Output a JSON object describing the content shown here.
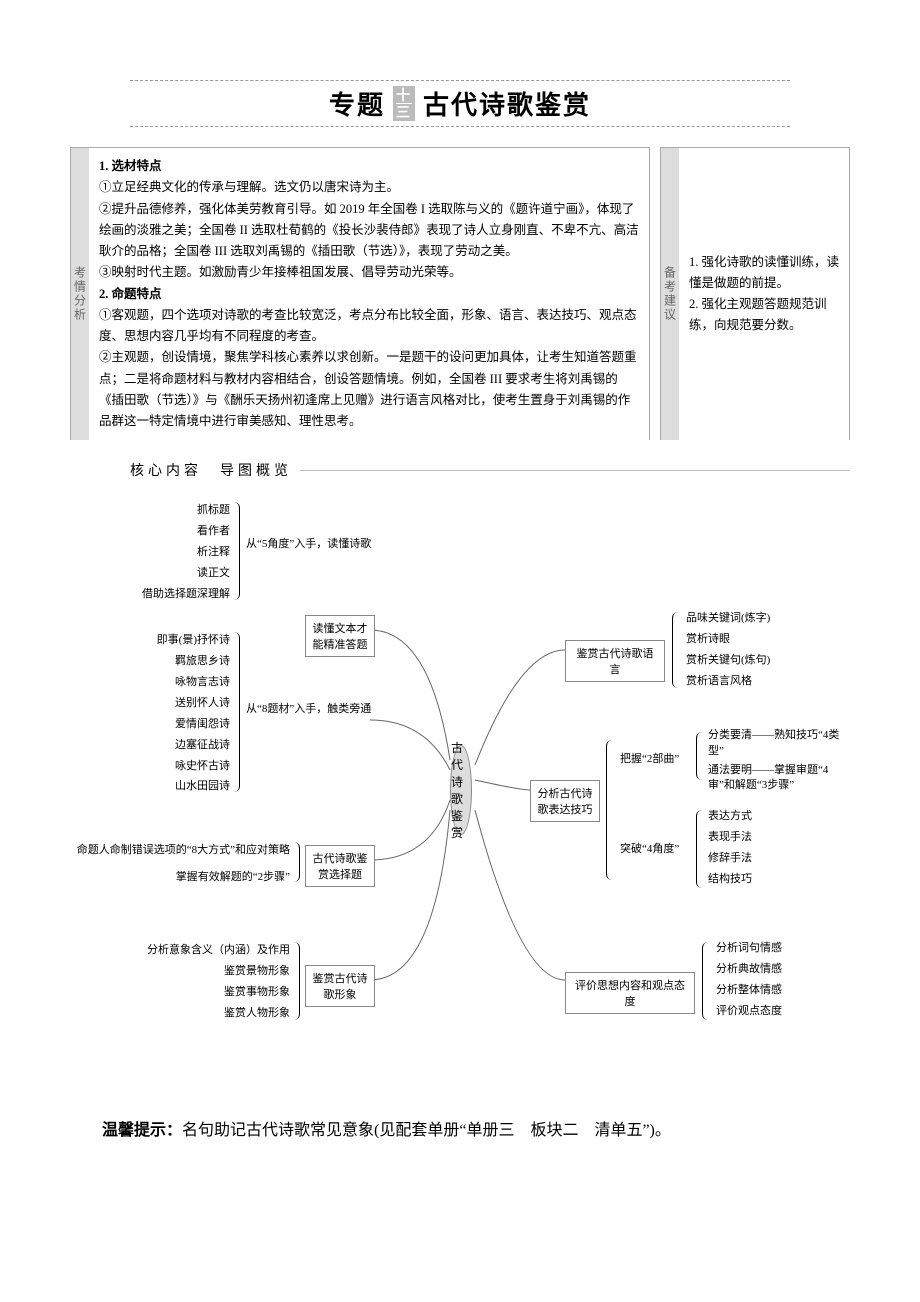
{
  "title": {
    "topic": "专题",
    "num_top": "十",
    "num_bottom": "三",
    "subject": "古代诗歌鉴赏"
  },
  "left": {
    "label": "考情分析",
    "h1": "1. 选材特点",
    "p1": "①立足经典文化的传承与理解。选文仍以唐宋诗为主。",
    "p2": "②提升品德修养，强化体美劳教育引导。如 2019 年全国卷 I 选取陈与义的《题许道宁画》，体现了绘画的淡雅之美；全国卷 II 选取杜荀鹤的《投长沙裴侍郎》表现了诗人立身刚直、不卑不亢、高洁耿介的品格；全国卷 III 选取刘禹锡的《插田歌（节选）》，表现了劳动之美。",
    "p3": "③映射时代主题。如激励青少年接棒祖国发展、倡导劳动光荣等。",
    "h2": "2. 命题特点",
    "p4": "①客观题，四个选项对诗歌的考查比较宽泛，考点分布比较全面，形象、语言、表达技巧、观点态度、思想内容几乎均有不同程度的考查。",
    "p5": "②主观题，创设情境，聚焦学科核心素养以求创新。一是题干的设问更加具体，让考生知道答题重点；二是将命题材料与教材内容相结合，创设答题情境。例如，全国卷 III 要求考生将刘禹锡的《插田歌（节选）》与《酬乐天扬州初逢席上见赠》进行语言风格对比，使考生置身于刘禹锡的作品群这一特定情境中进行审美感知、理性思考。"
  },
  "right": {
    "label": "备考建议",
    "i1": "1. 强化诗歌的读懂训练，读懂是做题的前提。",
    "i2": "2. 强化主观题答题规范训练，向规范要分数。"
  },
  "section": "核心内容　导图概览",
  "g1": {
    "a": "抓标题",
    "b": "看作者",
    "c": "析注释",
    "d": "读正文",
    "e": "借助选择题深理解",
    "lab": "从“5角度”入手，读懂诗歌"
  },
  "g2": {
    "a": "即事(景)抒怀诗",
    "b": "羁旅思乡诗",
    "c": "咏物言志诗",
    "d": "送别怀人诗",
    "e": "爱情闺怨诗",
    "f": "边塞征战诗",
    "g": "咏史怀古诗",
    "h": "山水田园诗",
    "lab": "从“8题材”入手，触类旁通"
  },
  "g3": {
    "a": "命题人命制错误选项的“8大方式”和应对策略",
    "b": "掌握有效解题的“2步骤”"
  },
  "g4": {
    "a": "分析意象含义（内涵）及作用",
    "b": "鉴赏景物形象",
    "c": "鉴赏事物形象",
    "d": "鉴赏人物形象"
  },
  "mid": {
    "a": "读懂文本才能精准答题",
    "b": "古代诗歌鉴赏选择题",
    "c": "鉴赏古代诗歌形象",
    "center": "古代诗歌鉴赏"
  },
  "r1": {
    "lab": "鉴赏古代诗歌语言",
    "a": "品味关键词(炼字)",
    "b": "赏析诗眼",
    "c": "赏析关键句(炼句)",
    "d": "赏析语言风格"
  },
  "r2": {
    "lab": "分析古代诗歌表达技巧",
    "s1": "把握“2部曲”",
    "a": "分类要清——熟知技巧“4类型”",
    "b": "通法要明——掌握审题“4审”和解题“3步骤”",
    "s2": "突破“4角度”",
    "c": "表达方式",
    "d": "表现手法",
    "e": "修辞手法",
    "f": "结构技巧"
  },
  "r3": {
    "lab": "评价思想内容和观点态度",
    "a": "分析词句情感",
    "b": "分析典故情感",
    "c": "分析整体情感",
    "d": "评价观点态度"
  },
  "footer": {
    "b": "温馨提示：",
    "t": "名句助记古代诗歌常见意象(见配套单册“单册三　板块二　清单五”)。"
  }
}
